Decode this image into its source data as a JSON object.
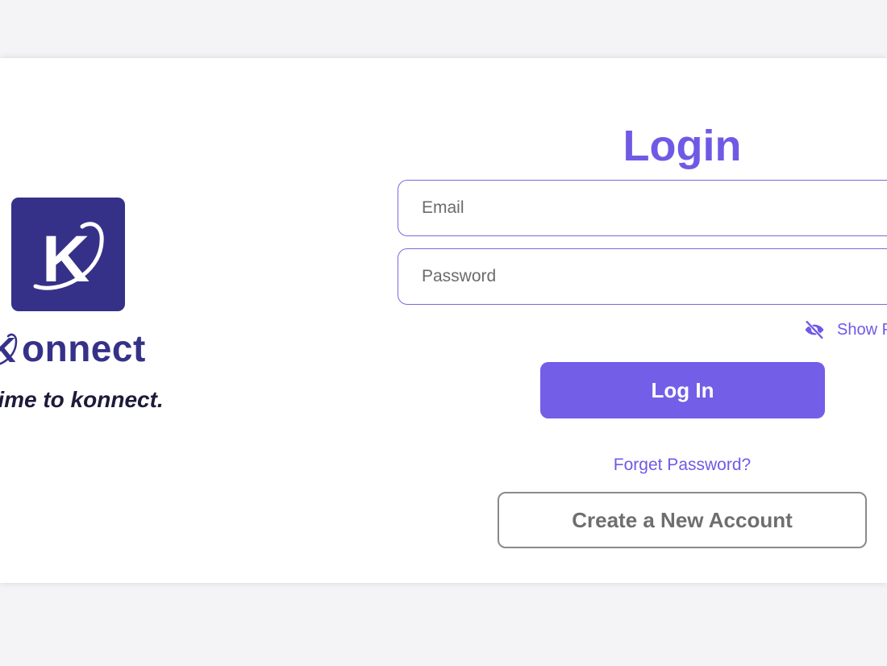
{
  "brand": {
    "name": "onnect",
    "tagline": "time to konnect.",
    "logo_icon": "konnect-k-logo-icon",
    "color": "#363188"
  },
  "login": {
    "title": "Login",
    "email_placeholder": "Email",
    "password_placeholder": "Password",
    "show_password_label": "Show Password",
    "show_password_icon": "eye-off-icon",
    "login_button": "Log In",
    "forget_password": "Forget Password?",
    "create_account": "Create a New Account",
    "accent_color": "#735ee8"
  }
}
